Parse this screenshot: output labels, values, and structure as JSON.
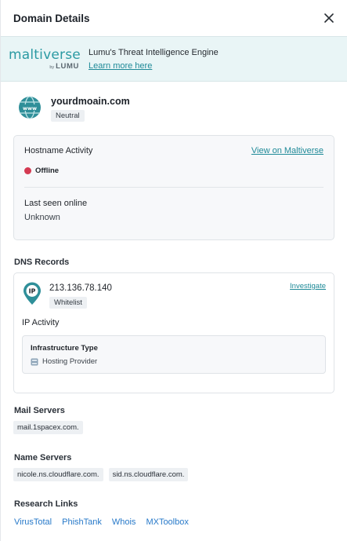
{
  "header": {
    "title": "Domain Details"
  },
  "banner": {
    "logo_word": "maltiverse",
    "logo_by": "by",
    "logo_brand": "LUMU",
    "tagline": "Lumu's Threat Intelligence Engine",
    "learn_more": "Learn more here"
  },
  "domain": {
    "name": "yourdmoain.com",
    "badge": "Neutral"
  },
  "hostname": {
    "title": "Hostname Activity",
    "view_link": "View on Maltiverse",
    "status": "Offline",
    "status_color": "#d43a52",
    "last_seen_label": "Last seen online",
    "last_seen_value": "Unknown"
  },
  "dns": {
    "title": "DNS Records",
    "ip": "213.136.78.140",
    "ip_badge": "Whitelist",
    "investigate": "Investigate",
    "ip_activity": "IP Activity",
    "infra_title": "Infrastructure Type",
    "infra_value": "Hosting Provider",
    "pin_label": "IP"
  },
  "mail": {
    "title": "Mail Servers",
    "items": [
      "mail.1spacex.com."
    ]
  },
  "name_servers": {
    "title": "Name Servers",
    "items": [
      "nicole.ns.cloudflare.com.",
      "sid.ns.cloudflare.com."
    ]
  },
  "research": {
    "title": "Research Links",
    "links": [
      "VirusTotal",
      "PhishTank",
      "Whois",
      "MXToolbox"
    ]
  },
  "colors": {
    "accent": "#1f8a98",
    "link_blue": "#2779c9",
    "banner_bg": "#e9f5f6"
  },
  "icons": {
    "close": "close-icon",
    "globe": "www-globe-icon",
    "pin": "ip-pin-icon",
    "server": "server-icon"
  }
}
